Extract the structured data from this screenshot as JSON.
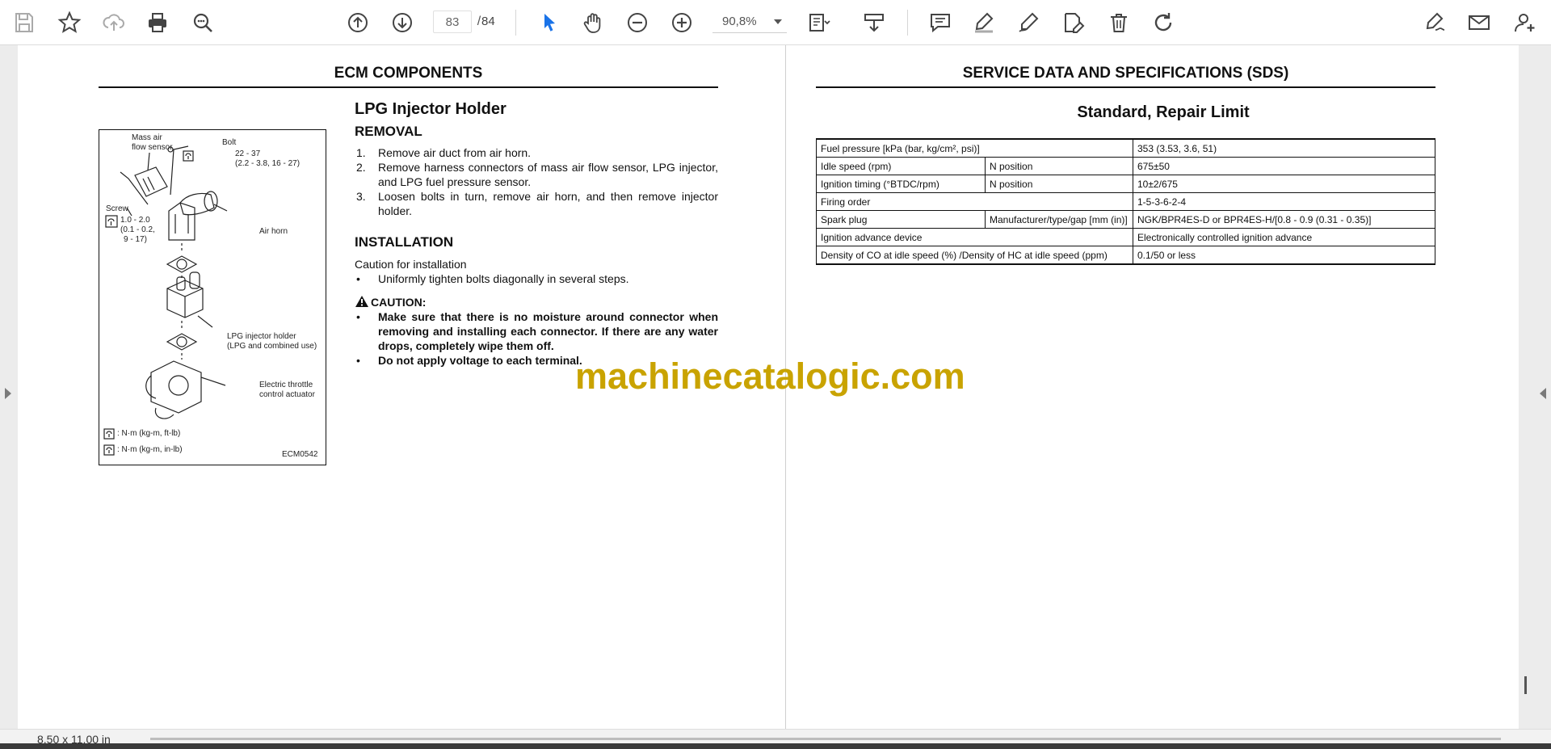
{
  "toolbar": {
    "current_page": "83",
    "page_separator": "/",
    "total_pages": "84",
    "zoom": "90,8%"
  },
  "status": {
    "page_size": "8,50 x 11,00 in"
  },
  "left_page": {
    "section_title": "ECM COMPONENTS",
    "heading": "LPG Injector Holder",
    "removal_title": "REMOVAL",
    "removal_steps": [
      {
        "num": "1.",
        "text": "Remove air duct from air horn."
      },
      {
        "num": "2.",
        "text": "Remove harness connectors of mass air flow sensor, LPG injector, and LPG fuel pressure sensor."
      },
      {
        "num": "3.",
        "text": "Loosen bolts in turn, remove air horn, and then remove injector holder."
      }
    ],
    "installation_title": "INSTALLATION",
    "caution_intro": "Caution for installation",
    "install_bullet": "Uniformly tighten bolts diagonally in several steps.",
    "caution_label": "CAUTION:",
    "caution_bullets": [
      "Make sure that there is no moisture around connector when removing and installing each connector. If there are any water drops, completely wipe them off.",
      "Do not apply voltage to each terminal."
    ],
    "bullet_char": "•",
    "figure": {
      "mass_air_1": "Mass air",
      "mass_air_2": "flow sensor",
      "bolt": "Bolt",
      "bolt_torque_1": "22 - 37",
      "bolt_torque_2": "(2.2 - 3.8, 16 - 27)",
      "screw": "Screw",
      "screw_torque_1": "1.0 - 2.0",
      "screw_torque_2": "(0.1 - 0.2,",
      "screw_torque_3": "9 - 17)",
      "air_horn": "Air horn",
      "lpg_holder_1": "LPG injector holder",
      "lpg_holder_2": "(LPG and combined use)",
      "throttle_1": "Electric throttle",
      "throttle_2": "control actuator",
      "legend_1": ": N·m (kg-m, ft-lb)",
      "legend_2": ": N·m (kg-m, in-lb)",
      "code": "ECM0542"
    }
  },
  "right_page": {
    "section_title": "SERVICE DATA AND SPECIFICATIONS (SDS)",
    "subtitle": "Standard, Repair Limit",
    "rows": [
      {
        "item": "Fuel pressure [kPa (bar, kg/cm², psi)]",
        "cond": "",
        "value": "353 (3.53, 3.6, 51)"
      },
      {
        "item": "Idle speed (rpm)",
        "cond": "N position",
        "value": "675±50"
      },
      {
        "item": "Ignition timing (°BTDC/rpm)",
        "cond": "N position",
        "value": "10±2/675"
      },
      {
        "item": "Firing order",
        "cond": "",
        "value": "1-5-3-6-2-4"
      },
      {
        "item": "Spark plug",
        "cond": "Manufacturer/type/gap [mm (in)]",
        "value": "NGK/BPR4ES-D or BPR4ES-H/[0.8 - 0.9 (0.31 - 0.35)]"
      },
      {
        "item": "Ignition advance device",
        "cond": "",
        "value": "Electronically controlled ignition advance"
      },
      {
        "item": "Density of CO at idle speed (%) /Density of HC at idle speed (ppm)",
        "cond": "",
        "value": "0.1/50 or less"
      }
    ]
  },
  "watermark": "machinecatalogic.com",
  "colors": {
    "select_tool": "#1a73e8",
    "watermark": "#c9a300",
    "icon": "#444444"
  }
}
